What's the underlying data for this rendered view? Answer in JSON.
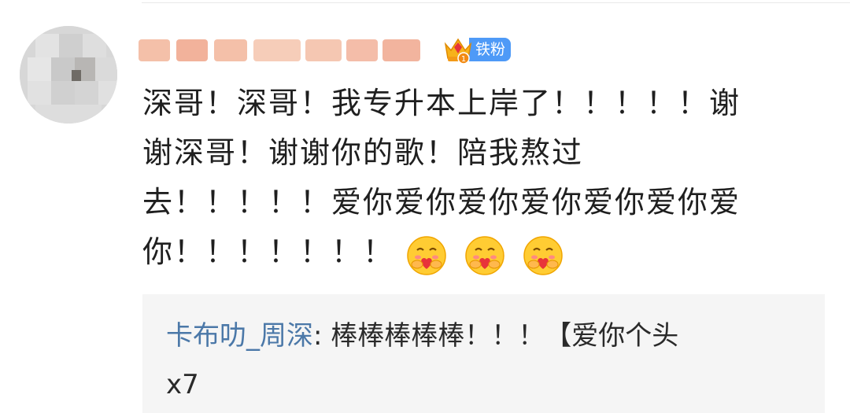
{
  "comment": {
    "username": "",
    "badge_label": "铁粉",
    "badge_level": "1",
    "text_lines": [
      "深哥！深哥！我专升本上岸了！！！！！谢",
      "谢深哥！谢谢你的歌！陪我熬过",
      "去！！！！！爱你爱你爱你爱你爱你爱你爱",
      "你！！！！！！！"
    ],
    "emojis": [
      "hug-face-icon",
      "hug-face-icon",
      "hug-face-icon"
    ]
  },
  "reply": {
    "author": "卡布叻_周深",
    "separator": ": ",
    "text_line1": "棒棒棒棒棒！！！【爱你个头",
    "text_line2": "x7"
  },
  "colors": {
    "badge_blue": "#4e9af7",
    "reply_name": "#4b78a8",
    "reply_bg": "#f5f5f5"
  }
}
